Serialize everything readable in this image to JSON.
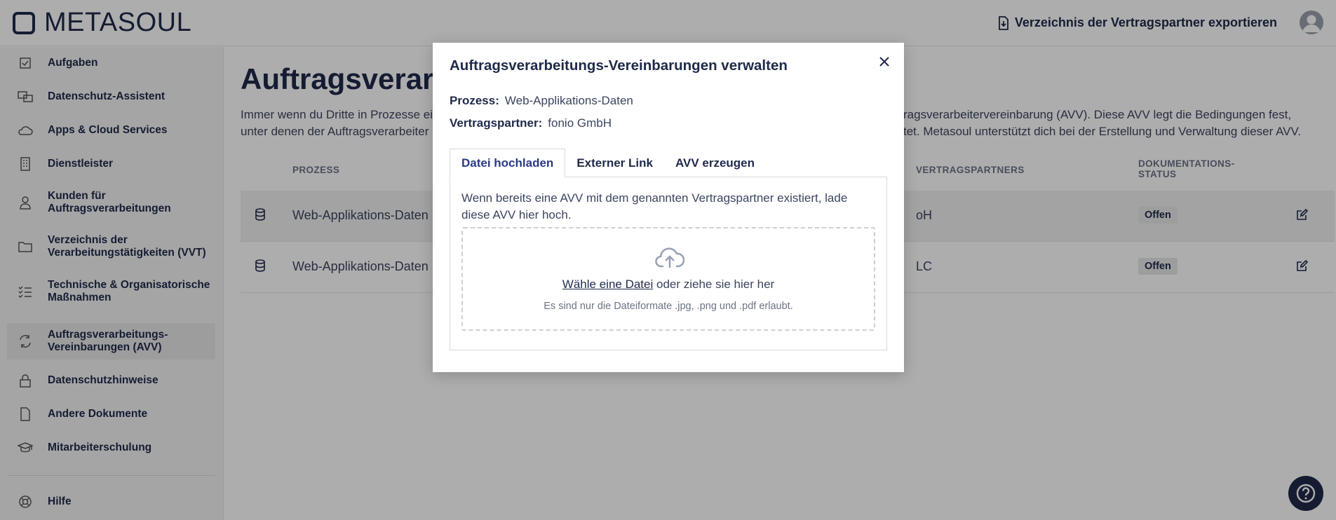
{
  "header": {
    "logo_text": "METASOUL",
    "export_label": "Verzeichnis der Vertragspartner exportieren"
  },
  "sidebar": {
    "items": [
      {
        "label": "Aufgaben",
        "icon": "checkbox-icon"
      },
      {
        "label": "Datenschutz-Assistent",
        "icon": "assistant-icon"
      },
      {
        "label": "Apps & Cloud Services",
        "icon": "cloud-icon"
      },
      {
        "label": "Dienstleister",
        "icon": "building-icon"
      },
      {
        "label": "Kunden für Auftragsverarbeitungen",
        "icon": "person-icon"
      },
      {
        "label": "Verzeichnis der Verarbeitungstätigkeiten (VVT)",
        "icon": "folder-icon"
      },
      {
        "label": "Technische & Organisatorische Maßnahmen",
        "icon": "checklist-icon"
      },
      {
        "label": "Auftragsverarbeitungs-Vereinbarungen (AVV)",
        "icon": "arrows-icon"
      },
      {
        "label": "Datenschutzhinweise",
        "icon": "lock-icon"
      },
      {
        "label": "Andere Dokumente",
        "icon": "document-icon"
      },
      {
        "label": "Mitarbeiterschulung",
        "icon": "graduation-cap-icon"
      }
    ],
    "help_label": "Hilfe"
  },
  "main": {
    "title": "Auftragsverarb",
    "intro_left_1": "Immer wenn du Dritte in Prozesse ei",
    "intro_left_2": "unter denen der Auftragsverarbeiter",
    "intro_right_1": "ragsverarbeitervereinbarung (AVV). Diese AVV legt die Bedingungen fest,",
    "intro_right_2": "tet. Metasoul unterstützt dich bei der Erstellung und Verwaltung dieser AVV.",
    "columns": {
      "process": "PROZESS",
      "partner": "VERTRAGSPARTNERS",
      "status": "DOKUMENTATIONS-\nSTATUS"
    },
    "rows": [
      {
        "process": "Web-Applikations-Daten",
        "partner": "oH",
        "status": "Offen"
      },
      {
        "process": "Web-Applikations-Daten",
        "partner": "LC",
        "status": "Offen"
      }
    ]
  },
  "modal": {
    "title": "Auftragsverarbeitungs-Vereinbarungen verwalten",
    "process_key": "Prozess:",
    "process_value": "Web-Applikations-Daten",
    "partner_key": "Vertragspartner:",
    "partner_value": "fonio GmbH",
    "tabs": [
      "Datei hochladen",
      "Externer Link",
      "AVV erzeugen"
    ],
    "panel_text": "Wenn bereits eine AVV mit dem genannten Vertragspartner existiert, lade diese AVV hier hoch.",
    "drop_link": "Wähle eine Datei",
    "drop_text": " oder ziehe sie hier her",
    "drop_hint": "Es sind nur die Dateiformate .jpg, .png und .pdf erlaubt."
  },
  "colors": {
    "brand": "#1f2a4a",
    "active_tab": "#2b3a84",
    "overlay": "rgba(0,0,0,0.32)"
  }
}
